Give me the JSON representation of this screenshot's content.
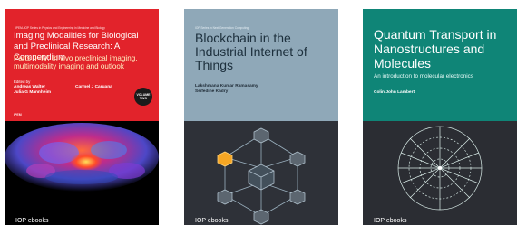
{
  "books": [
    {
      "series": "IPEM–IOP Series in Physics and Engineering in Medicine and Biology",
      "title": "Imaging Modalities for Biological and Preclinical Research: A Compendium",
      "subtitle": "Parts II–IV: In vivo preclinical imaging, multimodality imaging and outlook",
      "edited_by": "Edited by",
      "authors_left": "Andreas Walter\nJulia G Mannheim",
      "authors_right": "Carmel J Caruana",
      "volume_badge": "VOLUME TWO",
      "imprint": "IPEM",
      "publisher": "IOP ebooks",
      "accent": "#e2232b"
    },
    {
      "series": "IOP Series in Next Generation Computing",
      "title": "Blockchain in the Industrial Internet of Things",
      "authors": "Lakshmana Kumar Ramasamy\nSeifedine Kadry",
      "publisher": "IOP ebooks",
      "accent": "#8fa8b8"
    },
    {
      "series": "",
      "title": "Quantum Transport in Nanostructures and Molecules",
      "subtitle": "An introduction to molecular electronics",
      "authors": "Colin John Lambert",
      "publisher": "IOP ebooks",
      "accent": "#0f8577"
    }
  ]
}
